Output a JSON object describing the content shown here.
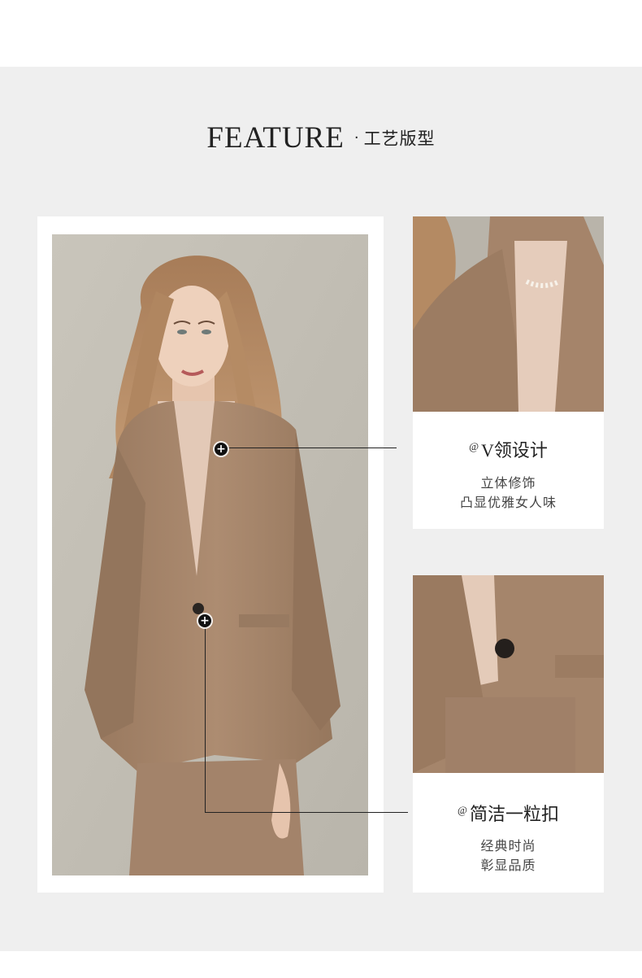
{
  "header": {
    "title_en": "FEATURE",
    "separator": "·",
    "title_zh": "工艺版型"
  },
  "features": [
    {
      "marker": "@",
      "title": "V领设计",
      "lines": [
        "立体修饰",
        "凸显优雅女人味"
      ]
    },
    {
      "marker": "@",
      "title": "简洁一粒扣",
      "lines": [
        "经典时尚",
        "彰显品质"
      ]
    }
  ],
  "hotspots": [
    {
      "icon": "plus-icon",
      "symbol": "+"
    },
    {
      "icon": "plus-icon",
      "symbol": "+"
    }
  ],
  "colors": {
    "panel_background": "#efefef",
    "card_background": "#ffffff",
    "text": "#222222",
    "jacket": "#a8876b",
    "blouse": "#e4cbbb"
  }
}
